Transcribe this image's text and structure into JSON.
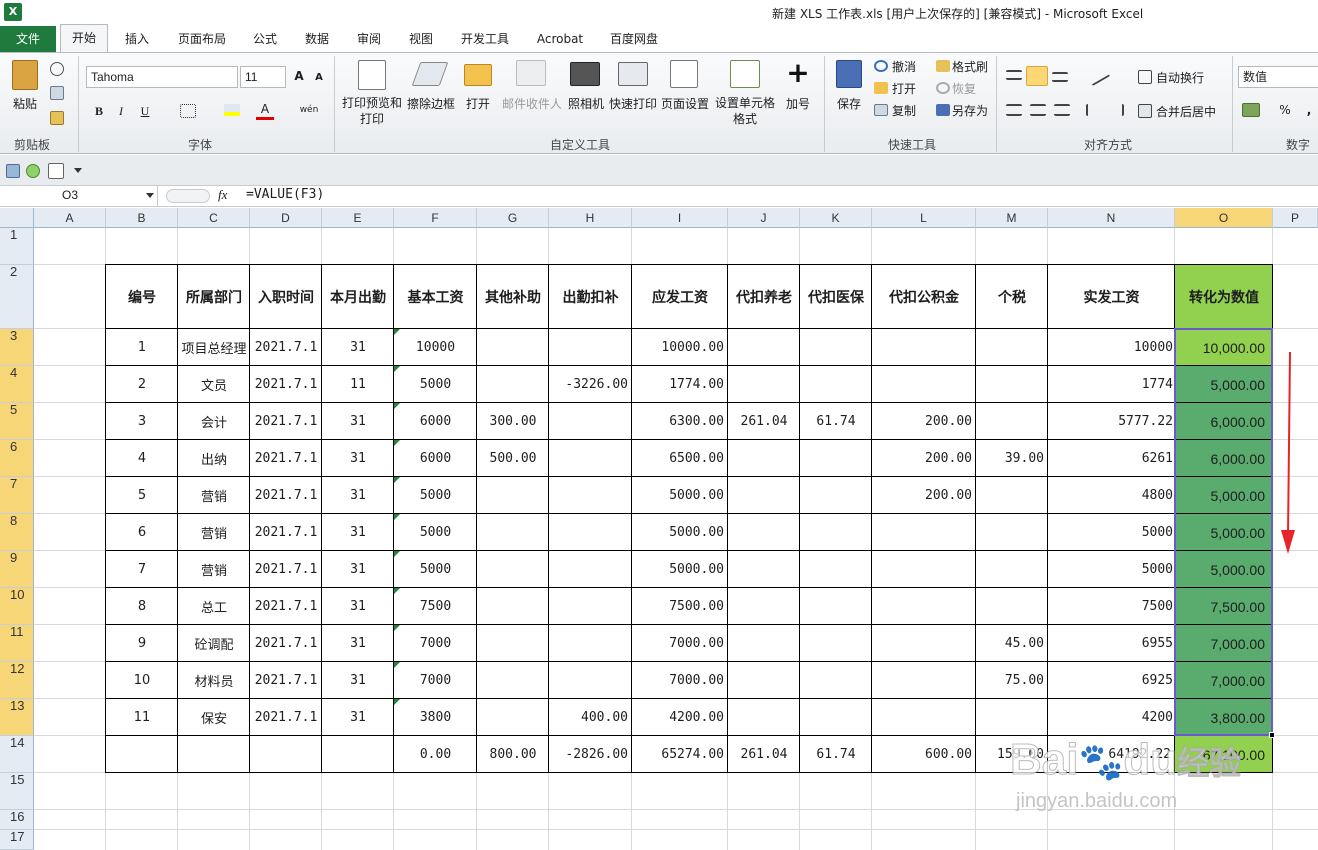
{
  "app": {
    "icon_letter": "X",
    "title": "新建 XLS 工作表.xls [用户上次保存的]  [兼容模式]  -  Microsoft Excel"
  },
  "tabs": {
    "file": "文件",
    "items": [
      "开始",
      "插入",
      "页面布局",
      "公式",
      "数据",
      "审阅",
      "视图",
      "开发工具",
      "Acrobat",
      "百度网盘"
    ]
  },
  "ribbon": {
    "clipboard": {
      "paste": "粘贴",
      "label": "剪贴板"
    },
    "font": {
      "name": "Tahoma",
      "size": "11",
      "bold": "B",
      "italic": "I",
      "underline": "U",
      "label": "字体",
      "grow": "A",
      "shrink": "A",
      "wen": "wén"
    },
    "custom": {
      "print_preview": "打印预览和打印",
      "erase_border": "擦除边框",
      "open": "打开",
      "mail_recipient": "邮件收件人",
      "camera": "照相机",
      "quick_print": "快速打印",
      "page_setup": "页面设置",
      "set_cell_format": "设置单元格格式",
      "add": "加号",
      "label": "自定义工具"
    },
    "quick": {
      "save": "保存",
      "undo": "撤消",
      "open": "打开",
      "copy": "复制",
      "format_painter": "格式刷",
      "redo": "恢复",
      "save_as": "另存为",
      "label": "快速工具"
    },
    "align": {
      "wrap": "自动换行",
      "merge": "合并后居中",
      "label": "对齐方式"
    },
    "number": {
      "format": "数值",
      "percent": "%",
      "comma": ",",
      "label": "数字"
    }
  },
  "formula_bar": {
    "name_box": "O3",
    "fx": "fx",
    "formula": "=VALUE(F3)"
  },
  "columns": [
    "A",
    "B",
    "C",
    "D",
    "E",
    "F",
    "G",
    "H",
    "I",
    "J",
    "K",
    "L",
    "M",
    "N",
    "O",
    "P"
  ],
  "rows": [
    "1",
    "2",
    "3",
    "4",
    "5",
    "6",
    "7",
    "8",
    "9",
    "10",
    "11",
    "12",
    "13",
    "14",
    "15",
    "16",
    "17"
  ],
  "table": {
    "headers": [
      "编号",
      "所属部门",
      "入职时间",
      "本月出勤",
      "基本工资",
      "其他补助",
      "出勤扣补",
      "应发工资",
      "代扣养老",
      "代扣医保",
      "代扣公积金",
      "个税",
      "实发工资",
      "转化为数值"
    ],
    "rows": [
      [
        "1",
        "项目总经理",
        "2021.7.1",
        "31",
        "10000",
        "",
        "",
        "10000.00",
        "",
        "",
        "",
        "",
        "10000",
        "10,000.00"
      ],
      [
        "2",
        "文员",
        "2021.7.1",
        "11",
        "5000",
        "",
        "-3226.00",
        "1774.00",
        "",
        "",
        "",
        "",
        "1774",
        "5,000.00"
      ],
      [
        "3",
        "会计",
        "2021.7.1",
        "31",
        "6000",
        "300.00",
        "",
        "6300.00",
        "261.04",
        "61.74",
        "200.00",
        "",
        "5777.22",
        "6,000.00"
      ],
      [
        "4",
        "出纳",
        "2021.7.1",
        "31",
        "6000",
        "500.00",
        "",
        "6500.00",
        "",
        "",
        "200.00",
        "39.00",
        "6261",
        "6,000.00"
      ],
      [
        "5",
        "营销",
        "2021.7.1",
        "31",
        "5000",
        "",
        "",
        "5000.00",
        "",
        "",
        "200.00",
        "",
        "4800",
        "5,000.00"
      ],
      [
        "6",
        "营销",
        "2021.7.1",
        "31",
        "5000",
        "",
        "",
        "5000.00",
        "",
        "",
        "",
        "",
        "5000",
        "5,000.00"
      ],
      [
        "7",
        "营销",
        "2021.7.1",
        "31",
        "5000",
        "",
        "",
        "5000.00",
        "",
        "",
        "",
        "",
        "5000",
        "5,000.00"
      ],
      [
        "8",
        "总工",
        "2021.7.1",
        "31",
        "7500",
        "",
        "",
        "7500.00",
        "",
        "",
        "",
        "",
        "7500",
        "7,500.00"
      ],
      [
        "9",
        "砼调配",
        "2021.7.1",
        "31",
        "7000",
        "",
        "",
        "7000.00",
        "",
        "",
        "",
        "45.00",
        "6955",
        "7,000.00"
      ],
      [
        "10",
        "材料员",
        "2021.7.1",
        "31",
        "7000",
        "",
        "",
        "7000.00",
        "",
        "",
        "",
        "75.00",
        "6925",
        "7,000.00"
      ],
      [
        "11",
        "保安",
        "2021.7.1",
        "31",
        "3800",
        "",
        "400.00",
        "4200.00",
        "",
        "",
        "",
        "",
        "4200",
        "3,800.00"
      ]
    ],
    "totals": [
      "",
      "",
      "",
      "",
      "0.00",
      "800.00",
      "-2826.00",
      "65274.00",
      "261.04",
      "61.74",
      "600.00",
      "159.00",
      "64192.22",
      "67,100.00"
    ]
  },
  "watermark": {
    "brand": "Bai",
    "brand2": "du",
    "brand3": "经验",
    "url": "jingyan.baidu.com"
  },
  "colors": {
    "accent": "#1f7a3d",
    "selected": "#5aab6e",
    "header_green": "#92d050",
    "header_sel": "#f7d678",
    "arrow": "#e8242b"
  }
}
